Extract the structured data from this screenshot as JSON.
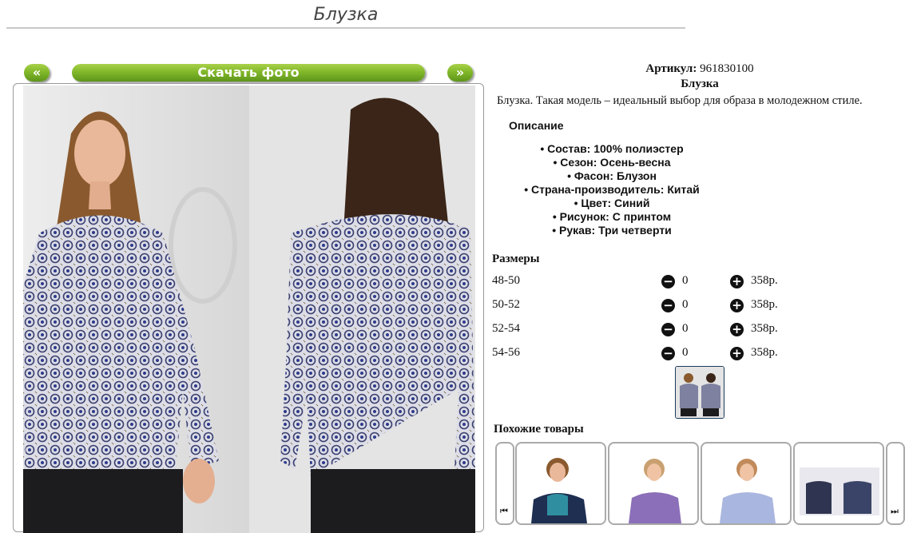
{
  "page": {
    "title": "Блузка"
  },
  "gallery": {
    "prev_label": "«",
    "download_label": "Скачать фото",
    "next_label": "»"
  },
  "product": {
    "article_label": "Артикул:",
    "article_value": "961830100",
    "name": "Блузка",
    "short_description": "Блузка. Такая модель – идеальный выбор для образа в молодежном стиле.",
    "description_title": "Описание",
    "attributes": [
      "Состав: 100% полиэстер",
      "Сезон: Осень-весна",
      "Фасон: Блузон",
      "Страна-производитель: Китай",
      "Цвет: Синий",
      "Рисунок: С принтом",
      "Рукав: Три четверти"
    ]
  },
  "sizes": {
    "title": "Размеры",
    "rows": [
      {
        "size": "48-50",
        "qty": "0",
        "price": "358р."
      },
      {
        "size": "50-52",
        "qty": "0",
        "price": "358р."
      },
      {
        "size": "52-54",
        "qty": "0",
        "price": "358р."
      },
      {
        "size": "54-56",
        "qty": "0",
        "price": "358р."
      }
    ]
  },
  "similar": {
    "title": "Похожие товары"
  },
  "icons": {
    "minus": "minus-circle-icon",
    "plus": "plus-circle-icon",
    "carousel_prev": "skip-back-icon",
    "carousel_next": "skip-forward-icon"
  },
  "colors": {
    "accent_green": "#82b82a",
    "frame_border": "#999999"
  }
}
